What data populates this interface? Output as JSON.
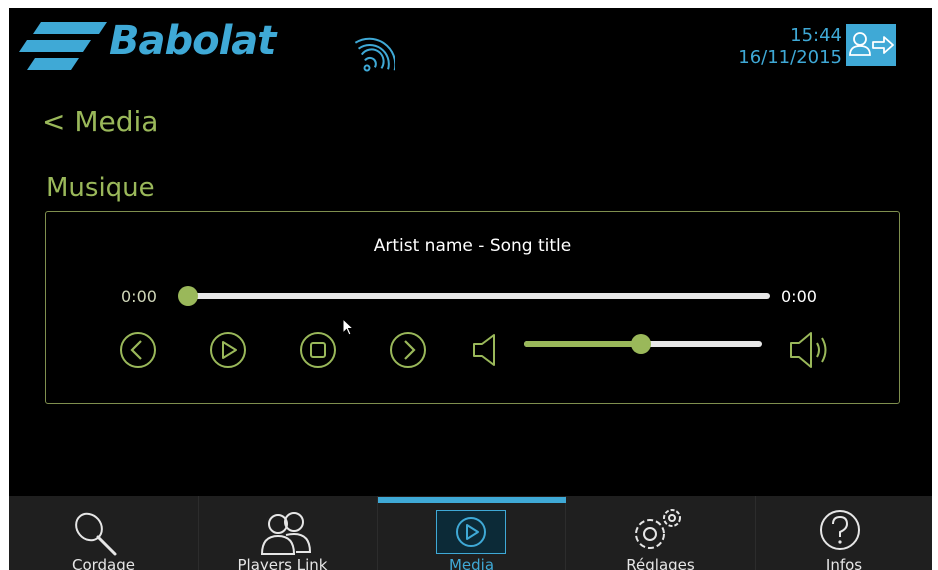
{
  "header": {
    "brand": "Babolat",
    "time": "15:44",
    "date": "16/11/2015",
    "icons": [
      "babolat-logo-icon",
      "wifi-icon",
      "logout-icon"
    ]
  },
  "navigation": {
    "back_label": "< Media"
  },
  "section": {
    "title": "Musique"
  },
  "player": {
    "track": "Artist name - Song title",
    "elapsed": "0:00",
    "duration": "0:00",
    "progress": 0.0,
    "volume": 0.49,
    "controls": [
      "previous",
      "play",
      "stop",
      "next"
    ]
  },
  "tabs": [
    {
      "label": "Cordage",
      "icon": "racket-icon",
      "active": false
    },
    {
      "label": "Players Link",
      "icon": "players-icon",
      "active": false
    },
    {
      "label": "Media",
      "icon": "play-icon",
      "active": true
    },
    {
      "label": "Réglages",
      "icon": "gears-icon",
      "active": false
    },
    {
      "label": "Infos",
      "icon": "help-icon",
      "active": false
    }
  ],
  "colors": {
    "accent_blue": "#3fa9d6",
    "accent_green": "#9ab85a",
    "background": "#000000",
    "nav_background": "#1f1f1f"
  }
}
